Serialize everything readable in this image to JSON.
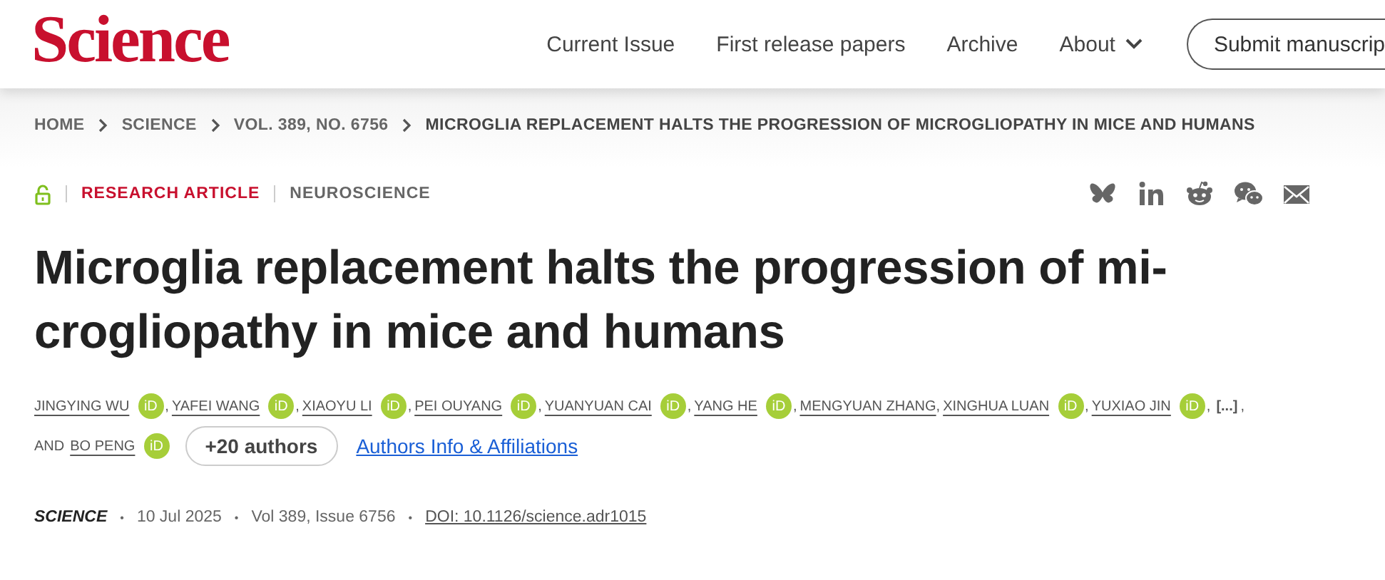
{
  "header": {
    "logo": "Science",
    "nav": [
      {
        "label": "Current Issue",
        "kind": "link"
      },
      {
        "label": "First release papers",
        "kind": "link"
      },
      {
        "label": "Archive",
        "kind": "link"
      },
      {
        "label": "About",
        "kind": "dropdown"
      }
    ],
    "submit_button": "Submit manuscrip"
  },
  "breadcrumbs": [
    {
      "label": "HOME",
      "current": false
    },
    {
      "label": "SCIENCE",
      "current": false
    },
    {
      "label": "VOL. 389, NO. 6756",
      "current": false
    },
    {
      "label": "MICROGLIA REPLACEMENT HALTS THE PROGRESSION OF MICROGLIOPATHY IN MICE AND HUMANS",
      "current": true
    }
  ],
  "article": {
    "open_access": true,
    "type": "RESEARCH ARTICLE",
    "subject": "NEUROSCIENCE",
    "share": [
      {
        "kind": "bluesky"
      },
      {
        "kind": "linkedin"
      },
      {
        "kind": "reddit"
      },
      {
        "kind": "wechat"
      },
      {
        "kind": "email"
      }
    ],
    "title_lines": [
      "Microglia replacement halts the progression of mi-",
      "crogliopathy in mice and humans"
    ],
    "authors": [
      {
        "name": "JINGYING WU",
        "orcid": "iD",
        "separator": ","
      },
      {
        "name": "YAFEI WANG",
        "orcid": "iD",
        "separator": ","
      },
      {
        "name": "XIAOYU LI",
        "orcid": "iD",
        "separator": ","
      },
      {
        "name": "PEI OUYANG",
        "orcid": "iD",
        "separator": ","
      },
      {
        "name": "YUANYUAN CAI",
        "orcid": "iD",
        "separator": ","
      },
      {
        "name": "YANG HE",
        "orcid": "iD",
        "separator": ","
      },
      {
        "name": "MENGYUAN ZHANG",
        "separator": ","
      },
      {
        "name": "XINGHUA LUAN",
        "orcid": "iD",
        "separator": ","
      },
      {
        "name": "YUXIAO JIN",
        "orcid": "iD",
        "separator": ","
      }
    ],
    "more_marker": "[...]",
    "more_separator": ",",
    "conjunction": "AND",
    "last_author": {
      "name": "BO PENG",
      "orcid": "iD"
    },
    "more_authors_button": "+20 authors",
    "affiliations_link": "Authors Info & Affiliations",
    "meta": {
      "journal": "SCIENCE",
      "date": "10 Jul 2025",
      "volume": "Vol 389, Issue 6756",
      "doi": "DOI: 10.1126/science.adr1015",
      "dot": "•"
    }
  }
}
